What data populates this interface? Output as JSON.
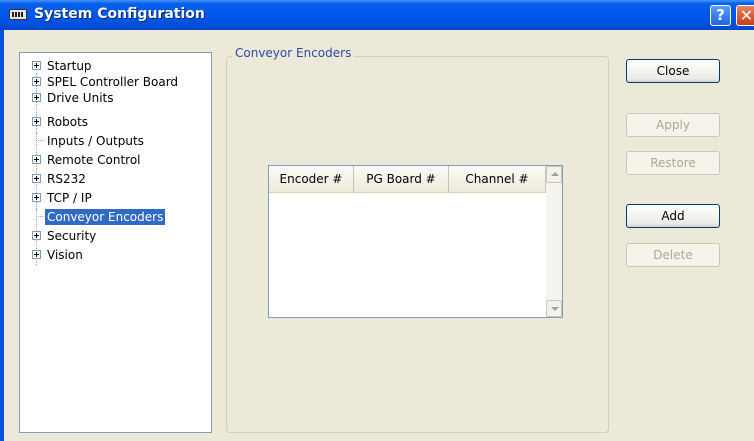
{
  "window": {
    "title": "System Configuration",
    "help_label": "?",
    "close_label": "✕"
  },
  "tree": {
    "items": [
      {
        "label": "Startup"
      },
      {
        "label": "SPEL Controller Board"
      },
      {
        "label": "Drive Units"
      },
      {
        "label": "Robots"
      },
      {
        "label": "Inputs / Outputs"
      },
      {
        "label": "Remote Control"
      },
      {
        "label": "RS232"
      },
      {
        "label": "TCP / IP"
      },
      {
        "label": "Conveyor Encoders"
      },
      {
        "label": "Security"
      },
      {
        "label": "Vision"
      }
    ],
    "selected": "Conveyor Encoders"
  },
  "panel": {
    "title": "Conveyor Encoders",
    "table": {
      "columns": [
        "Encoder #",
        "PG Board #",
        "Channel #"
      ],
      "rows": []
    }
  },
  "buttons": {
    "close": "Close",
    "apply": "Apply",
    "restore": "Restore",
    "add": "Add",
    "delete": "Delete"
  },
  "colors": {
    "titlebar": "#0054e3",
    "selection": "#316ac5",
    "group_title": "#2a4aa8"
  }
}
